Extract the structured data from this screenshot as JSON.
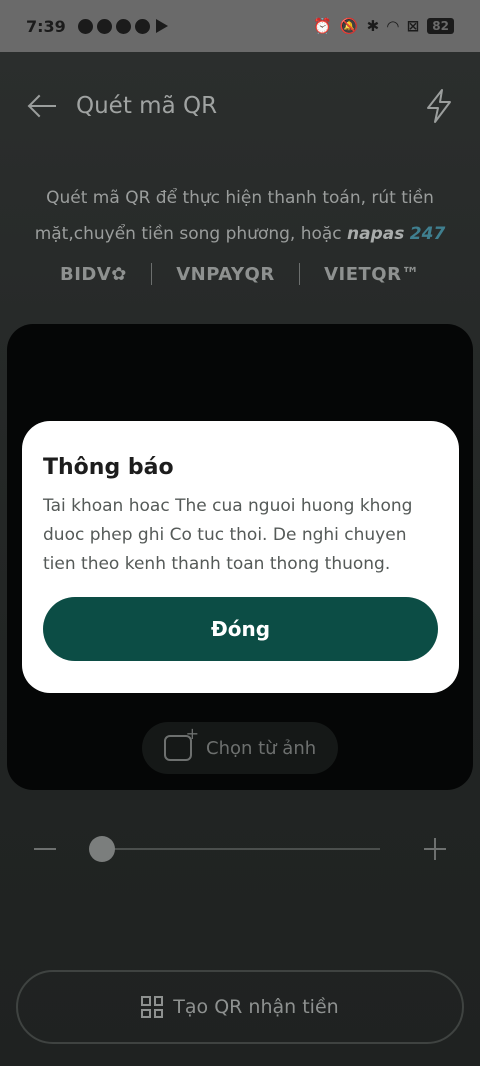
{
  "status_bar": {
    "time": "7:39",
    "battery": "82"
  },
  "header": {
    "title": "Quét mã QR"
  },
  "description": {
    "line": "Quét mã QR để thực hiện thanh toán, rút tiền mặt,chuyển tiền song phương, hoặc",
    "napas": "napas",
    "napas_num": "247"
  },
  "partners": [
    "BIDV✿",
    "VNPAYQR",
    "VIETQR™"
  ],
  "scanner": {
    "pick_image_label": "Chọn từ ảnh",
    "zoom_level": 0.0
  },
  "create_qr": {
    "label": "Tạo QR nhận tiền"
  },
  "dialog": {
    "title": "Thông báo",
    "message": "Tai khoan hoac The cua nguoi huong khong duoc phep ghi Co tuc thoi. De nghi chuyen tien theo kenh thanh toan thong thuong.",
    "close_label": "Đóng",
    "accent": "#0c4d45"
  },
  "icons": [
    "back-arrow-icon",
    "flash-icon",
    "image-plus-icon",
    "qr-code-icon",
    "minus-icon",
    "plus-icon"
  ]
}
